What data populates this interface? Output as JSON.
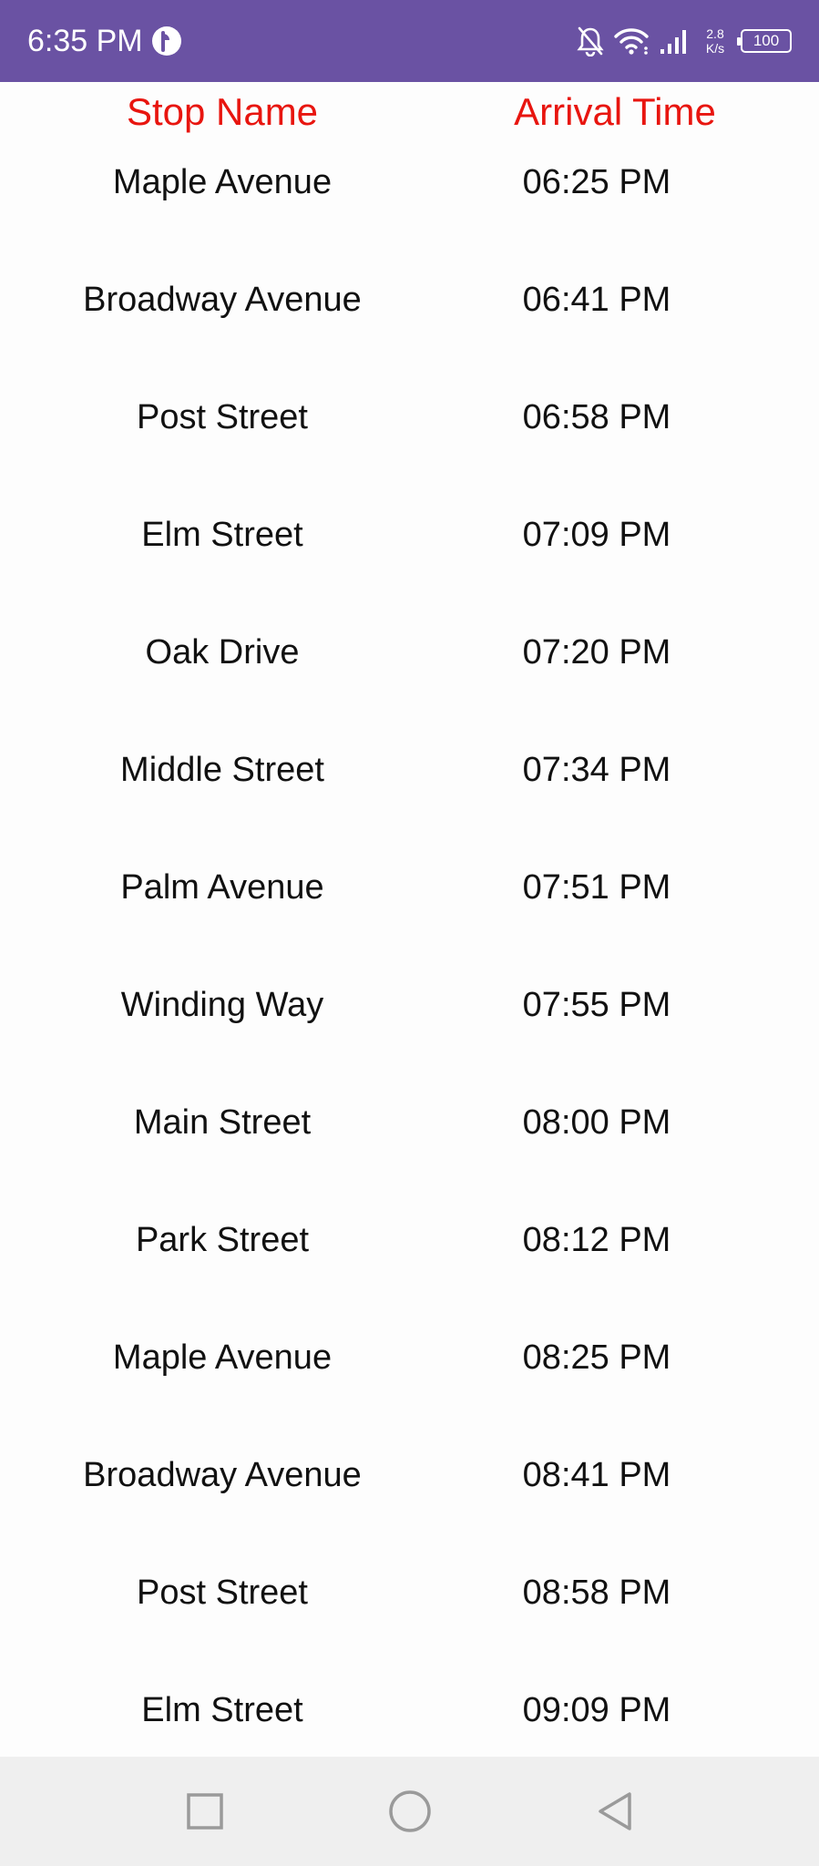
{
  "status_bar": {
    "time": "6:35 PM",
    "net_speed_value": "2.8",
    "net_speed_unit": "K/s",
    "battery": "100"
  },
  "table": {
    "headers": {
      "stop": "Stop Name",
      "time": "Arrival Time"
    },
    "rows": [
      {
        "stop": "Maple Avenue",
        "time": "06:25 PM"
      },
      {
        "stop": "Broadway Avenue",
        "time": "06:41 PM"
      },
      {
        "stop": "Post Street",
        "time": "06:58 PM"
      },
      {
        "stop": "Elm Street",
        "time": "07:09 PM"
      },
      {
        "stop": "Oak Drive",
        "time": "07:20 PM"
      },
      {
        "stop": "Middle Street",
        "time": "07:34 PM"
      },
      {
        "stop": "Palm Avenue",
        "time": "07:51 PM"
      },
      {
        "stop": "Winding Way",
        "time": "07:55 PM"
      },
      {
        "stop": "Main Street",
        "time": "08:00 PM"
      },
      {
        "stop": "Park Street",
        "time": "08:12 PM"
      },
      {
        "stop": "Maple Avenue",
        "time": "08:25 PM"
      },
      {
        "stop": "Broadway Avenue",
        "time": "08:41 PM"
      },
      {
        "stop": "Post Street",
        "time": "08:58 PM"
      },
      {
        "stop": "Elm Street",
        "time": "09:09 PM"
      }
    ]
  },
  "colors": {
    "status_bar_bg": "#6a52a3",
    "header_text": "#e8150f",
    "body_text": "#111111",
    "nav_bar_bg": "#efefef"
  },
  "icons": {
    "status_app": "app-status-icon",
    "notifications_muted": "bell-off-icon",
    "wifi": "wifi-icon",
    "signal": "cellular-signal-icon",
    "battery": "battery-icon",
    "nav_recents": "square-recents-icon",
    "nav_home": "circle-home-icon",
    "nav_back": "triangle-back-icon"
  }
}
